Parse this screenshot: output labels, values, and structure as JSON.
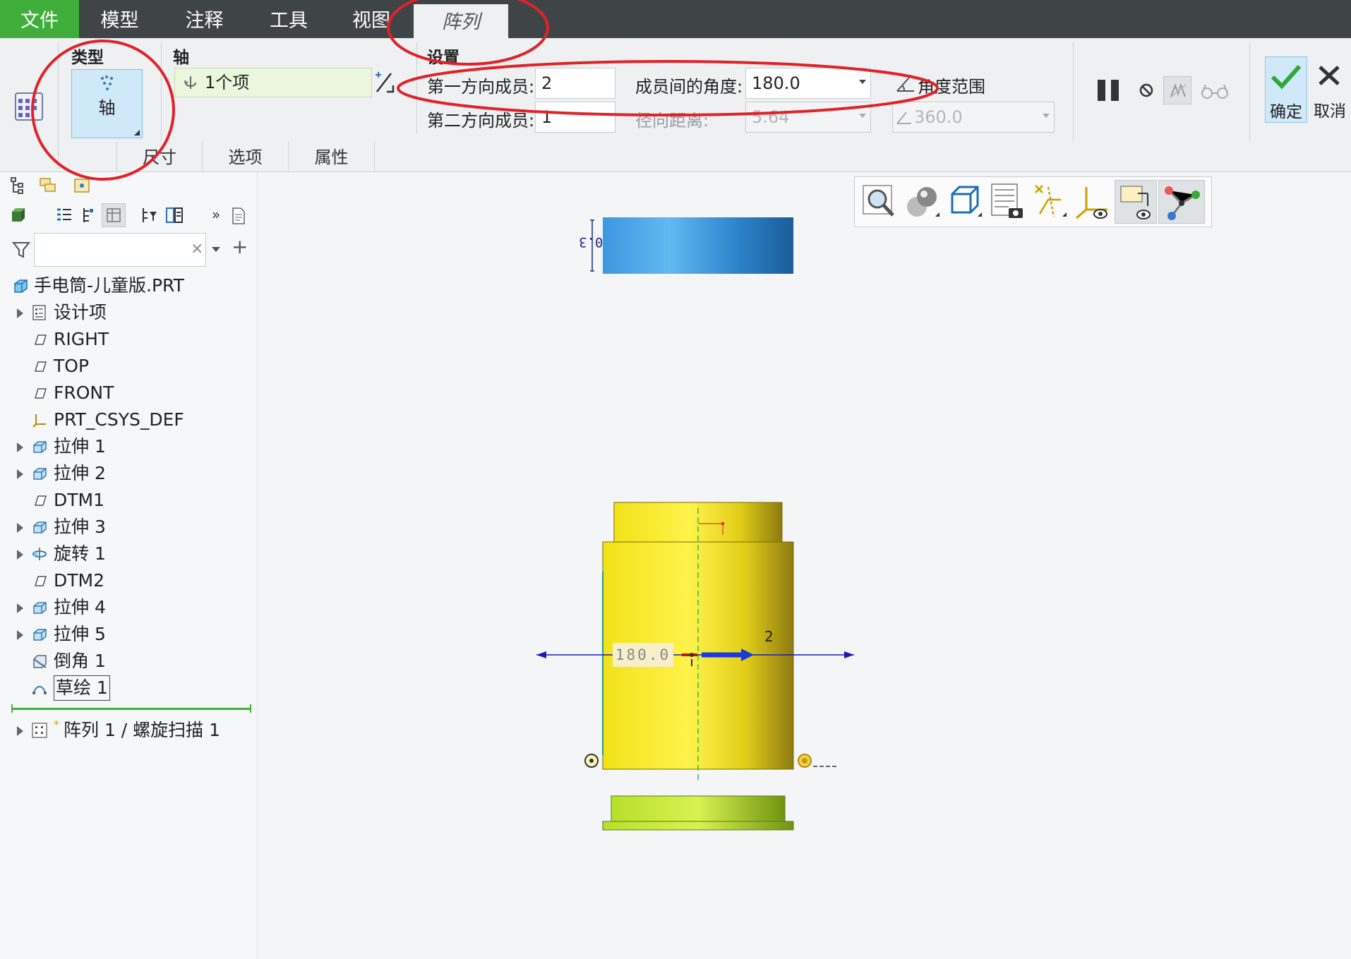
{
  "tabs": [
    {
      "label": "文件"
    },
    {
      "label": "模型"
    },
    {
      "label": "注释"
    },
    {
      "label": "工具"
    },
    {
      "label": "视图"
    },
    {
      "label": "阵列"
    }
  ],
  "ribbon": {
    "type_group": {
      "title": "类型",
      "button_label": "轴"
    },
    "axis_group": {
      "title": "轴",
      "collector_value": "1个项"
    },
    "settings": {
      "title": "设置",
      "first_dir_label": "第一方向成员:",
      "first_dir_value": "2",
      "second_dir_label": "第二方向成员:",
      "second_dir_value": "1",
      "angle_label": "成员间的角度:",
      "angle_value": "180.0",
      "radial_label": "径向距离:",
      "radial_value": "5.64",
      "angle_range_label": "角度范围",
      "angle_range_value": "360.0"
    },
    "confirm_label": "确定",
    "cancel_label": "取消",
    "subtabs": [
      "尺寸",
      "选项",
      "属性"
    ]
  },
  "model_tree": {
    "filter_placeholder": "",
    "items": [
      {
        "label": "手电筒-儿童版.PRT",
        "icon": "part-icon",
        "expandable": false
      },
      {
        "label": "设计项",
        "icon": "design-items-icon",
        "expandable": true
      },
      {
        "label": "RIGHT",
        "icon": "datum-plane-icon",
        "expandable": false
      },
      {
        "label": "TOP",
        "icon": "datum-plane-icon",
        "expandable": false
      },
      {
        "label": "FRONT",
        "icon": "datum-plane-icon",
        "expandable": false
      },
      {
        "label": "PRT_CSYS_DEF",
        "icon": "csys-icon",
        "expandable": false
      },
      {
        "label": "拉伸 1",
        "icon": "extrude-icon",
        "expandable": true
      },
      {
        "label": "拉伸 2",
        "icon": "extrude-icon",
        "expandable": true
      },
      {
        "label": "DTM1",
        "icon": "datum-plane-icon",
        "expandable": false
      },
      {
        "label": "拉伸 3",
        "icon": "extrude-icon",
        "expandable": true
      },
      {
        "label": "旋转 1",
        "icon": "revolve-icon",
        "expandable": true
      },
      {
        "label": "DTM2",
        "icon": "datum-plane-icon",
        "expandable": false
      },
      {
        "label": "拉伸 4",
        "icon": "extrude-icon",
        "expandable": true
      },
      {
        "label": "拉伸 5",
        "icon": "extrude-icon",
        "expandable": true
      },
      {
        "label": "倒角 1",
        "icon": "chamfer-icon",
        "expandable": false
      },
      {
        "label": "草绘 1",
        "icon": "sketch-icon",
        "expandable": false
      }
    ],
    "pattern_item": "阵列 1 / 螺旋扫描 1"
  },
  "viewport": {
    "dim_top_value": "0.3",
    "angle_dim_value": "180.0",
    "member_count_label": "2"
  },
  "colors": {
    "tab_bar": "#3f4446",
    "file_tab": "#3fae3a",
    "annotation_red": "#e0222a",
    "model_yellow": "#f4e31c",
    "model_blue": "#2e8fd8",
    "model_green": "#b9e22a"
  }
}
